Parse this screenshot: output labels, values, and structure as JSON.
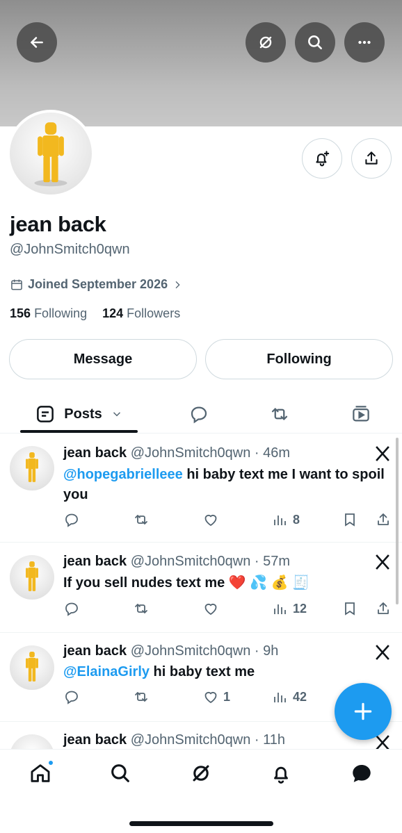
{
  "header": {
    "back_icon": "arrow-left-icon",
    "grok_icon": "grok-icon",
    "search_icon": "search-icon",
    "more_icon": "more-icon"
  },
  "profile": {
    "name": "jean back",
    "handle": "@JohnSmitch0qwn",
    "joined": "Joined September 2026",
    "following_count": "156",
    "following_label": "Following",
    "followers_count": "124",
    "followers_label": "Followers",
    "message_button": "Message",
    "following_button": "Following"
  },
  "tabs": {
    "posts_label": "Posts"
  },
  "tweets": [
    {
      "name": "jean back",
      "handle": "@JohnSmitch0qwn",
      "time": "· 46m",
      "mention": "@hopegabrielleee",
      "text": " hi baby text me I want to spoil you",
      "likes": "",
      "views": "8"
    },
    {
      "name": "jean back",
      "handle": "@JohnSmitch0qwn",
      "time": "· 57m",
      "mention": "",
      "text": "If you sell nudes text me ❤️ 💦 💰 🧾",
      "likes": "",
      "views": "12"
    },
    {
      "name": "jean back",
      "handle": "@JohnSmitch0qwn",
      "time": "· 9h",
      "mention": "@ElainaGirly",
      "text": " hi baby text me",
      "likes": "1",
      "views": "42"
    },
    {
      "name": "jean back",
      "handle": "@JohnSmitch0qwn",
      "time": "· 11h",
      "mention": "",
      "text": "",
      "likes": "",
      "views": ""
    }
  ],
  "colors": {
    "accent": "#1d9bf0",
    "text": "#0f1419",
    "secondary": "#536471"
  }
}
